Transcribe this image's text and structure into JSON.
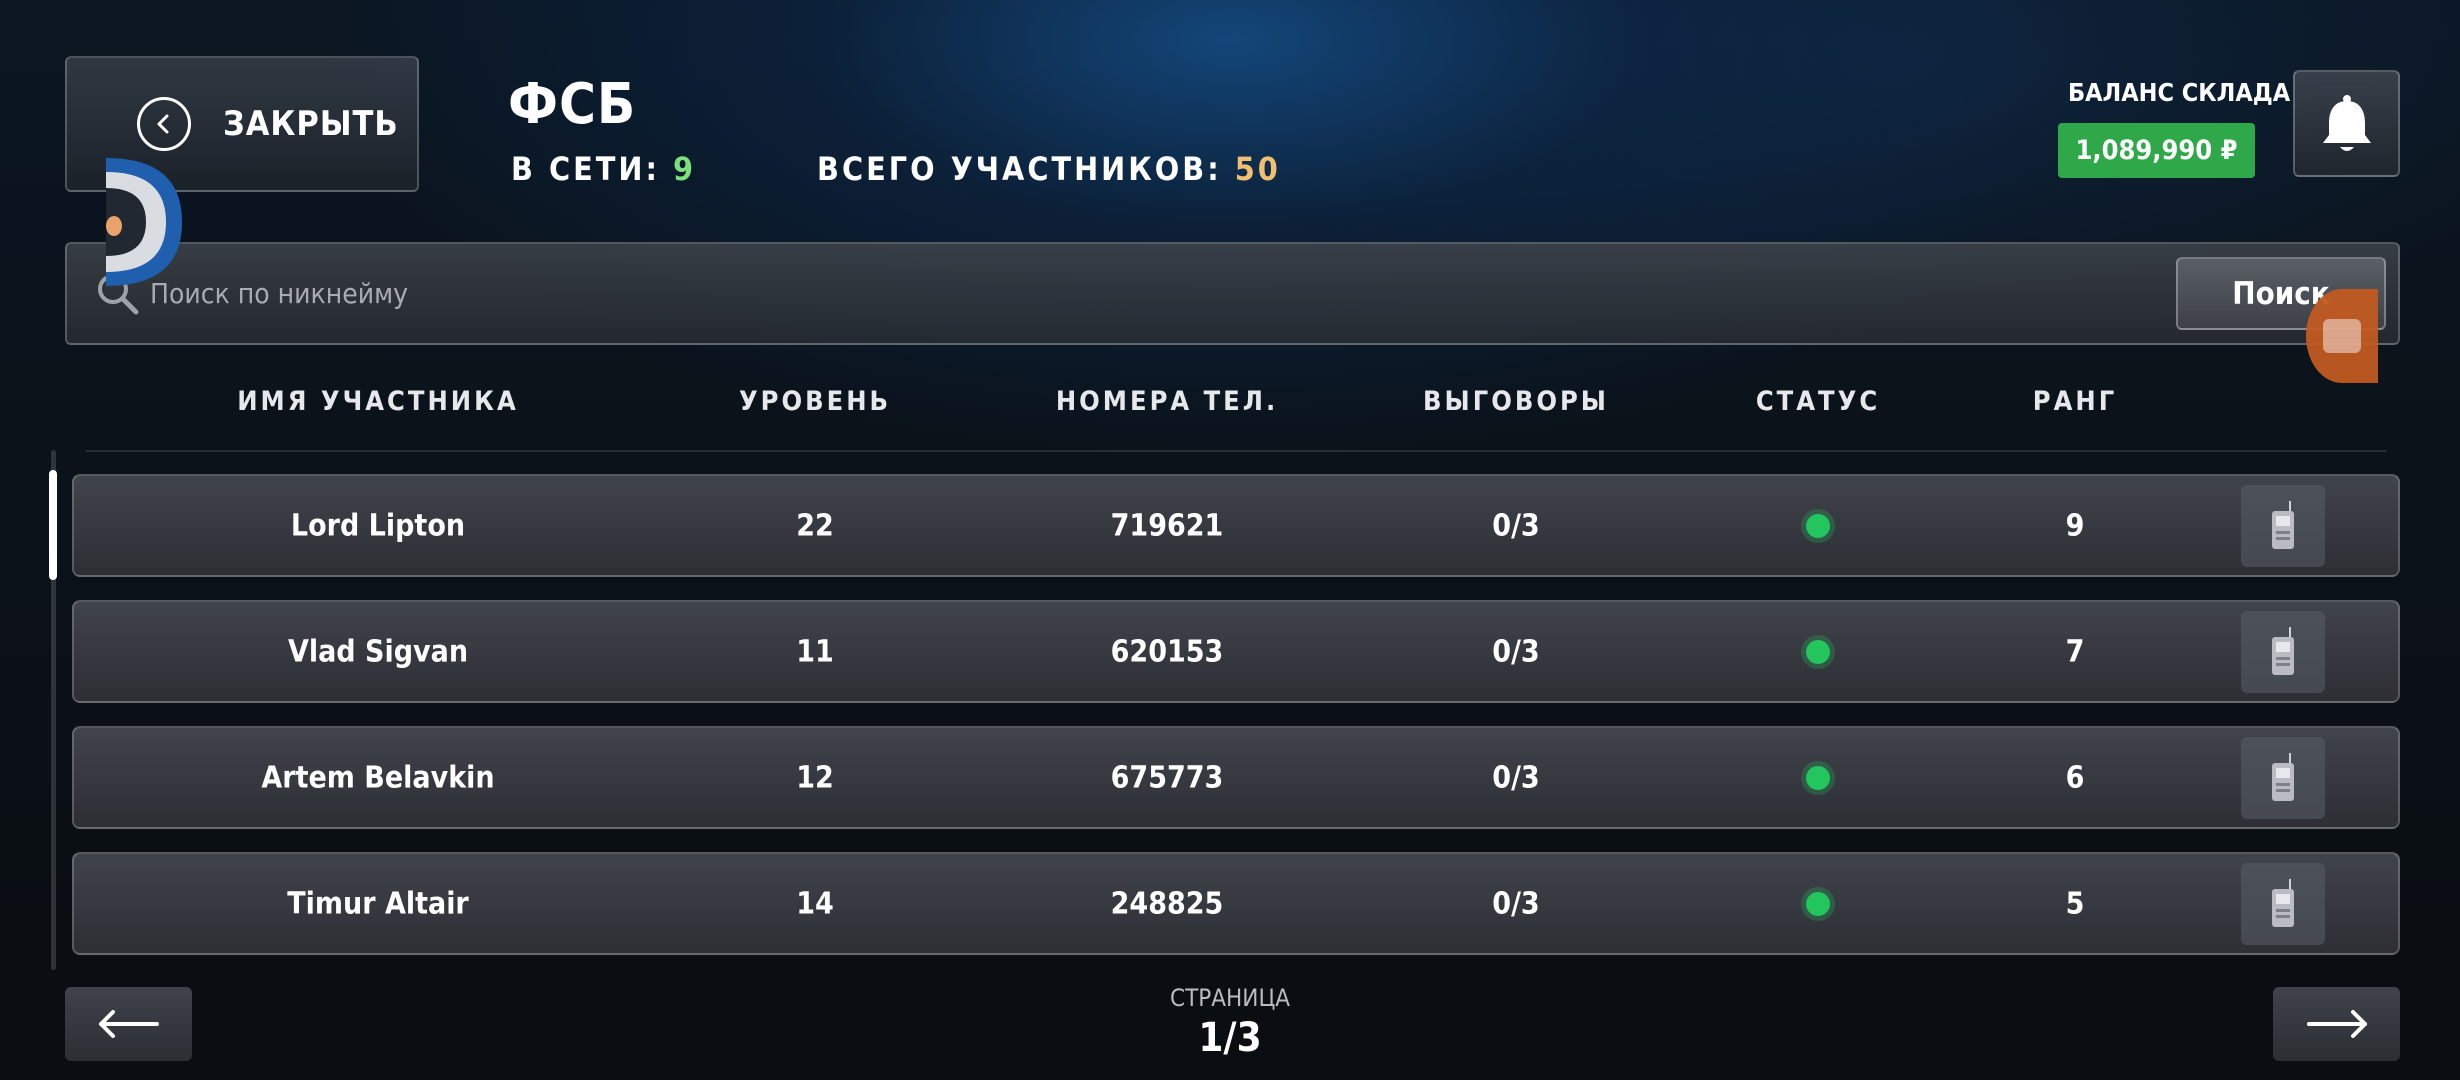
{
  "header": {
    "close_label": "ЗАКРЫТЬ",
    "org_title": "ФСБ",
    "online_label": "В СЕТИ:",
    "online_count": "9",
    "total_label": "ВСЕГО УЧАСТНИКОВ:",
    "total_count": "50",
    "balance_label": "БАЛАНС СКЛАДА",
    "balance_value": "1,089,990 ₽"
  },
  "search": {
    "placeholder": "Поиск по никнейму",
    "value": "",
    "button_label": "Поиск"
  },
  "table": {
    "columns": [
      "ИМЯ УЧАСТНИКА",
      "УРОВЕНЬ",
      "НОМЕРА ТЕЛ.",
      "ВЫГОВОРЫ",
      "СТАТУС",
      "РАНГ"
    ],
    "rows": [
      {
        "name": "Lord Lipton",
        "level": "22",
        "phone": "719621",
        "warnings": "0/3",
        "status": "online",
        "rank": "9"
      },
      {
        "name": "Vlad Sigvan",
        "level": "11",
        "phone": "620153",
        "warnings": "0/3",
        "status": "online",
        "rank": "7"
      },
      {
        "name": "Artem Belavkin",
        "level": "12",
        "phone": "675773",
        "warnings": "0/3",
        "status": "online",
        "rank": "6"
      },
      {
        "name": "Timur Altair",
        "level": "14",
        "phone": "248825",
        "warnings": "0/3",
        "status": "online",
        "rank": "5"
      }
    ]
  },
  "pagination": {
    "label": "СТРАНИЦА",
    "value": "1/3"
  },
  "colors": {
    "online_green": "#22c55e",
    "balance_green": "#2fa84a",
    "online_count": "#7ee07a",
    "total_count": "#f0c070"
  },
  "icons": {
    "close": "chevron-left-circle-icon",
    "bell": "bell-icon",
    "search": "magnifier-icon",
    "row_action": "walkie-talkie-icon",
    "prev": "arrow-left-icon",
    "next": "arrow-right-icon"
  }
}
